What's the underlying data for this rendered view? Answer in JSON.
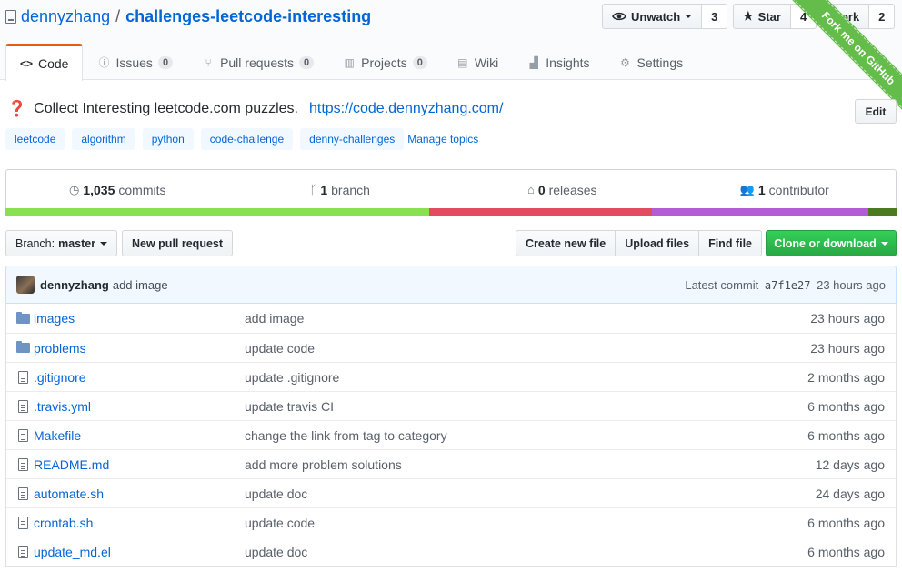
{
  "repo": {
    "owner": "dennyzhang",
    "separator": "/",
    "name": "challenges-leetcode-interesting"
  },
  "social": {
    "watch_label": "Unwatch",
    "watch_count": "3",
    "star_label": "Star",
    "star_count": "4",
    "fork_label": "Fork",
    "fork_count": "2"
  },
  "ribbon": {
    "text": "Fork me on GitHub"
  },
  "tabs": [
    {
      "label": "Code",
      "icon": "code-icon",
      "counter": null
    },
    {
      "label": "Issues",
      "icon": "issue-icon",
      "counter": "0"
    },
    {
      "label": "Pull requests",
      "icon": "pull-request-icon",
      "counter": "0"
    },
    {
      "label": "Projects",
      "icon": "project-icon",
      "counter": "0"
    },
    {
      "label": "Wiki",
      "icon": "book-icon",
      "counter": null
    },
    {
      "label": "Insights",
      "icon": "graph-icon",
      "counter": null
    },
    {
      "label": "Settings",
      "icon": "gear-icon",
      "counter": null
    }
  ],
  "description": {
    "emoji": "❓",
    "text": "Collect Interesting leetcode.com puzzles.",
    "url": "https://code.dennyzhang.com/",
    "edit_label": "Edit"
  },
  "topics": [
    "leetcode",
    "algorithm",
    "python",
    "code-challenge",
    "denny-challenges"
  ],
  "manage_topics_label": "Manage topics",
  "summary": {
    "commits_count": "1,035",
    "commits_label": "commits",
    "branches_count": "1",
    "branches_label": "branch",
    "releases_count": "0",
    "releases_label": "releases",
    "contributors_count": "1",
    "contributors_label": "contributor"
  },
  "language_bar": [
    {
      "color": "#89e051",
      "share": 47.5
    },
    {
      "color": "#e34c60",
      "share": 25.1
    },
    {
      "color": "#b45bd6",
      "share": 24.2
    },
    {
      "color": "#4c7a20",
      "share": 3.2
    }
  ],
  "toolbar": {
    "branch_prefix": "Branch:",
    "branch_name": "master",
    "new_pr_label": "New pull request",
    "create_file_label": "Create new file",
    "upload_files_label": "Upload files",
    "find_file_label": "Find file",
    "clone_label": "Clone or download"
  },
  "latest_commit": {
    "author": "dennyzhang",
    "message": "add image",
    "prefix": "Latest commit",
    "sha": "a7f1e27",
    "age": "23 hours ago"
  },
  "files": [
    {
      "name": "images",
      "type": "dir",
      "message": "add image",
      "age": "23 hours ago"
    },
    {
      "name": "problems",
      "type": "dir",
      "message": "update code",
      "age": "23 hours ago"
    },
    {
      "name": ".gitignore",
      "type": "file",
      "message": "update .gitignore",
      "age": "2 months ago"
    },
    {
      "name": ".travis.yml",
      "type": "file",
      "message": "update travis CI",
      "age": "6 months ago"
    },
    {
      "name": "Makefile",
      "type": "file",
      "message": "change the link from tag to category",
      "age": "6 months ago"
    },
    {
      "name": "README.md",
      "type": "file",
      "message": "add more problem solutions",
      "age": "12 days ago"
    },
    {
      "name": "automate.sh",
      "type": "file",
      "message": "update doc",
      "age": "24 days ago"
    },
    {
      "name": "crontab.sh",
      "type": "file",
      "message": "update code",
      "age": "6 months ago"
    },
    {
      "name": "update_md.el",
      "type": "file",
      "message": "update doc",
      "age": "6 months ago"
    }
  ]
}
